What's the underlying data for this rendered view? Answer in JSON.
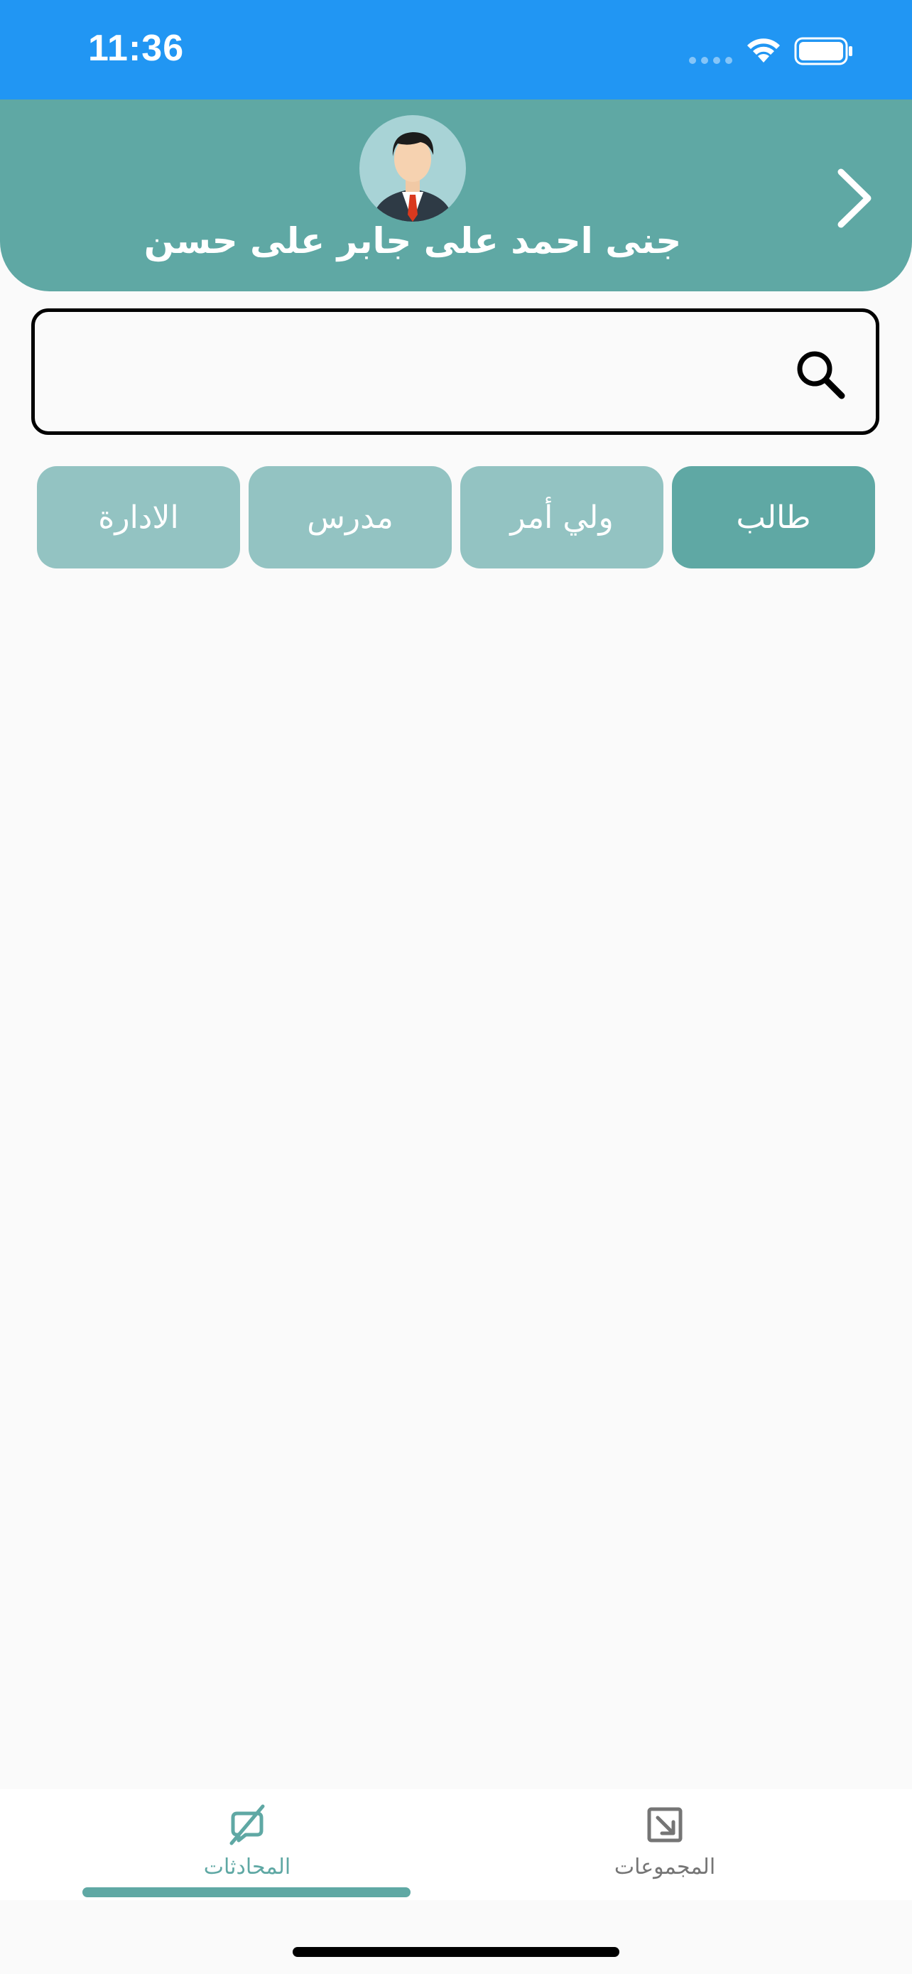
{
  "status_bar": {
    "time": "11:36",
    "icons": [
      "signal-dots-icon",
      "wifi-icon",
      "battery-icon"
    ]
  },
  "header": {
    "user_name": "جنى احمد على جابر على حسن",
    "avatar_icon": "businessman-avatar",
    "forward_icon": "chevron-right-icon"
  },
  "search": {
    "value": "",
    "placeholder": "",
    "icon": "search-icon"
  },
  "filter_tabs": [
    {
      "label": "طالب",
      "active": true
    },
    {
      "label": "ولي أمر",
      "active": false
    },
    {
      "label": "مدرس",
      "active": false
    },
    {
      "label": "الادارة",
      "active": false
    }
  ],
  "bottom_nav": {
    "items": [
      {
        "label": "المحادثات",
        "icon": "chat-off-icon",
        "active": true
      },
      {
        "label": "المجموعات",
        "icon": "open-external-icon",
        "active": false
      }
    ]
  },
  "colors": {
    "status_bar": "#2196f3",
    "primary": "#5fa8a4",
    "tab_inactive": "#93c3c2",
    "background": "#fafafa",
    "nav_inactive": "#757575"
  }
}
